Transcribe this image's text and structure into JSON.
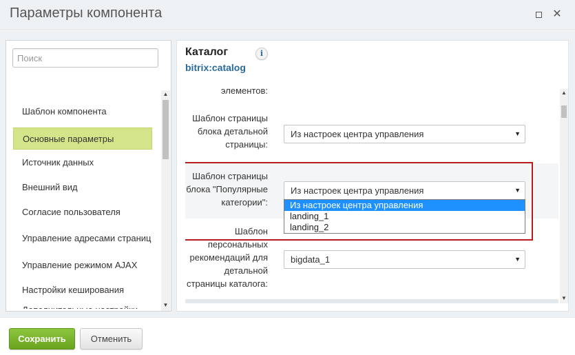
{
  "window": {
    "title": "Параметры компонента",
    "maximize_icon": "maximize-icon",
    "close_icon": "close-icon",
    "close_glyph": "✕"
  },
  "sidebar": {
    "search_placeholder": "Поиск",
    "items": [
      {
        "label": "Шаблон компонента"
      },
      {
        "label": "Основные параметры",
        "active": true
      },
      {
        "label": "Источник данных"
      },
      {
        "label": "Внешний вид"
      },
      {
        "label": "Согласие пользователя"
      },
      {
        "label": "Управление адресами страниц"
      },
      {
        "label": "Управление режимом AJAX"
      },
      {
        "label": "Настройки кеширования"
      },
      {
        "label": "Дополнительные настройки"
      }
    ]
  },
  "component": {
    "name": "Каталог",
    "id": "bitrix:catalog",
    "info_glyph": "i"
  },
  "properties": {
    "partial_label": "элементов:",
    "rows": [
      {
        "label_lines": [
          "Шаблон страницы",
          "блока детальной",
          "страницы:"
        ],
        "value": "Из настроек центра управления"
      },
      {
        "label_lines": [
          "Шаблон страницы",
          "блока \"Популярные",
          "категории\":"
        ],
        "value": "Из настроек центра управления",
        "options": [
          "Из настроек центра управления",
          "landing_1",
          "landing_2"
        ],
        "selected_option": 0
      },
      {
        "label_lines": [
          "Шаблон",
          "персональных",
          "рекомендаций для",
          "детальной",
          "страницы каталога:"
        ],
        "value": "bigdata_1"
      }
    ]
  },
  "footer": {
    "save_label": "Сохранить",
    "cancel_label": "Отменить"
  },
  "colors": {
    "active_nav": "#d4e488",
    "save_button": "#7ab52a",
    "highlight_border": "#b71c1c",
    "dropdown_selected": "#1e90ff",
    "component_id": "#2a6a9b"
  }
}
